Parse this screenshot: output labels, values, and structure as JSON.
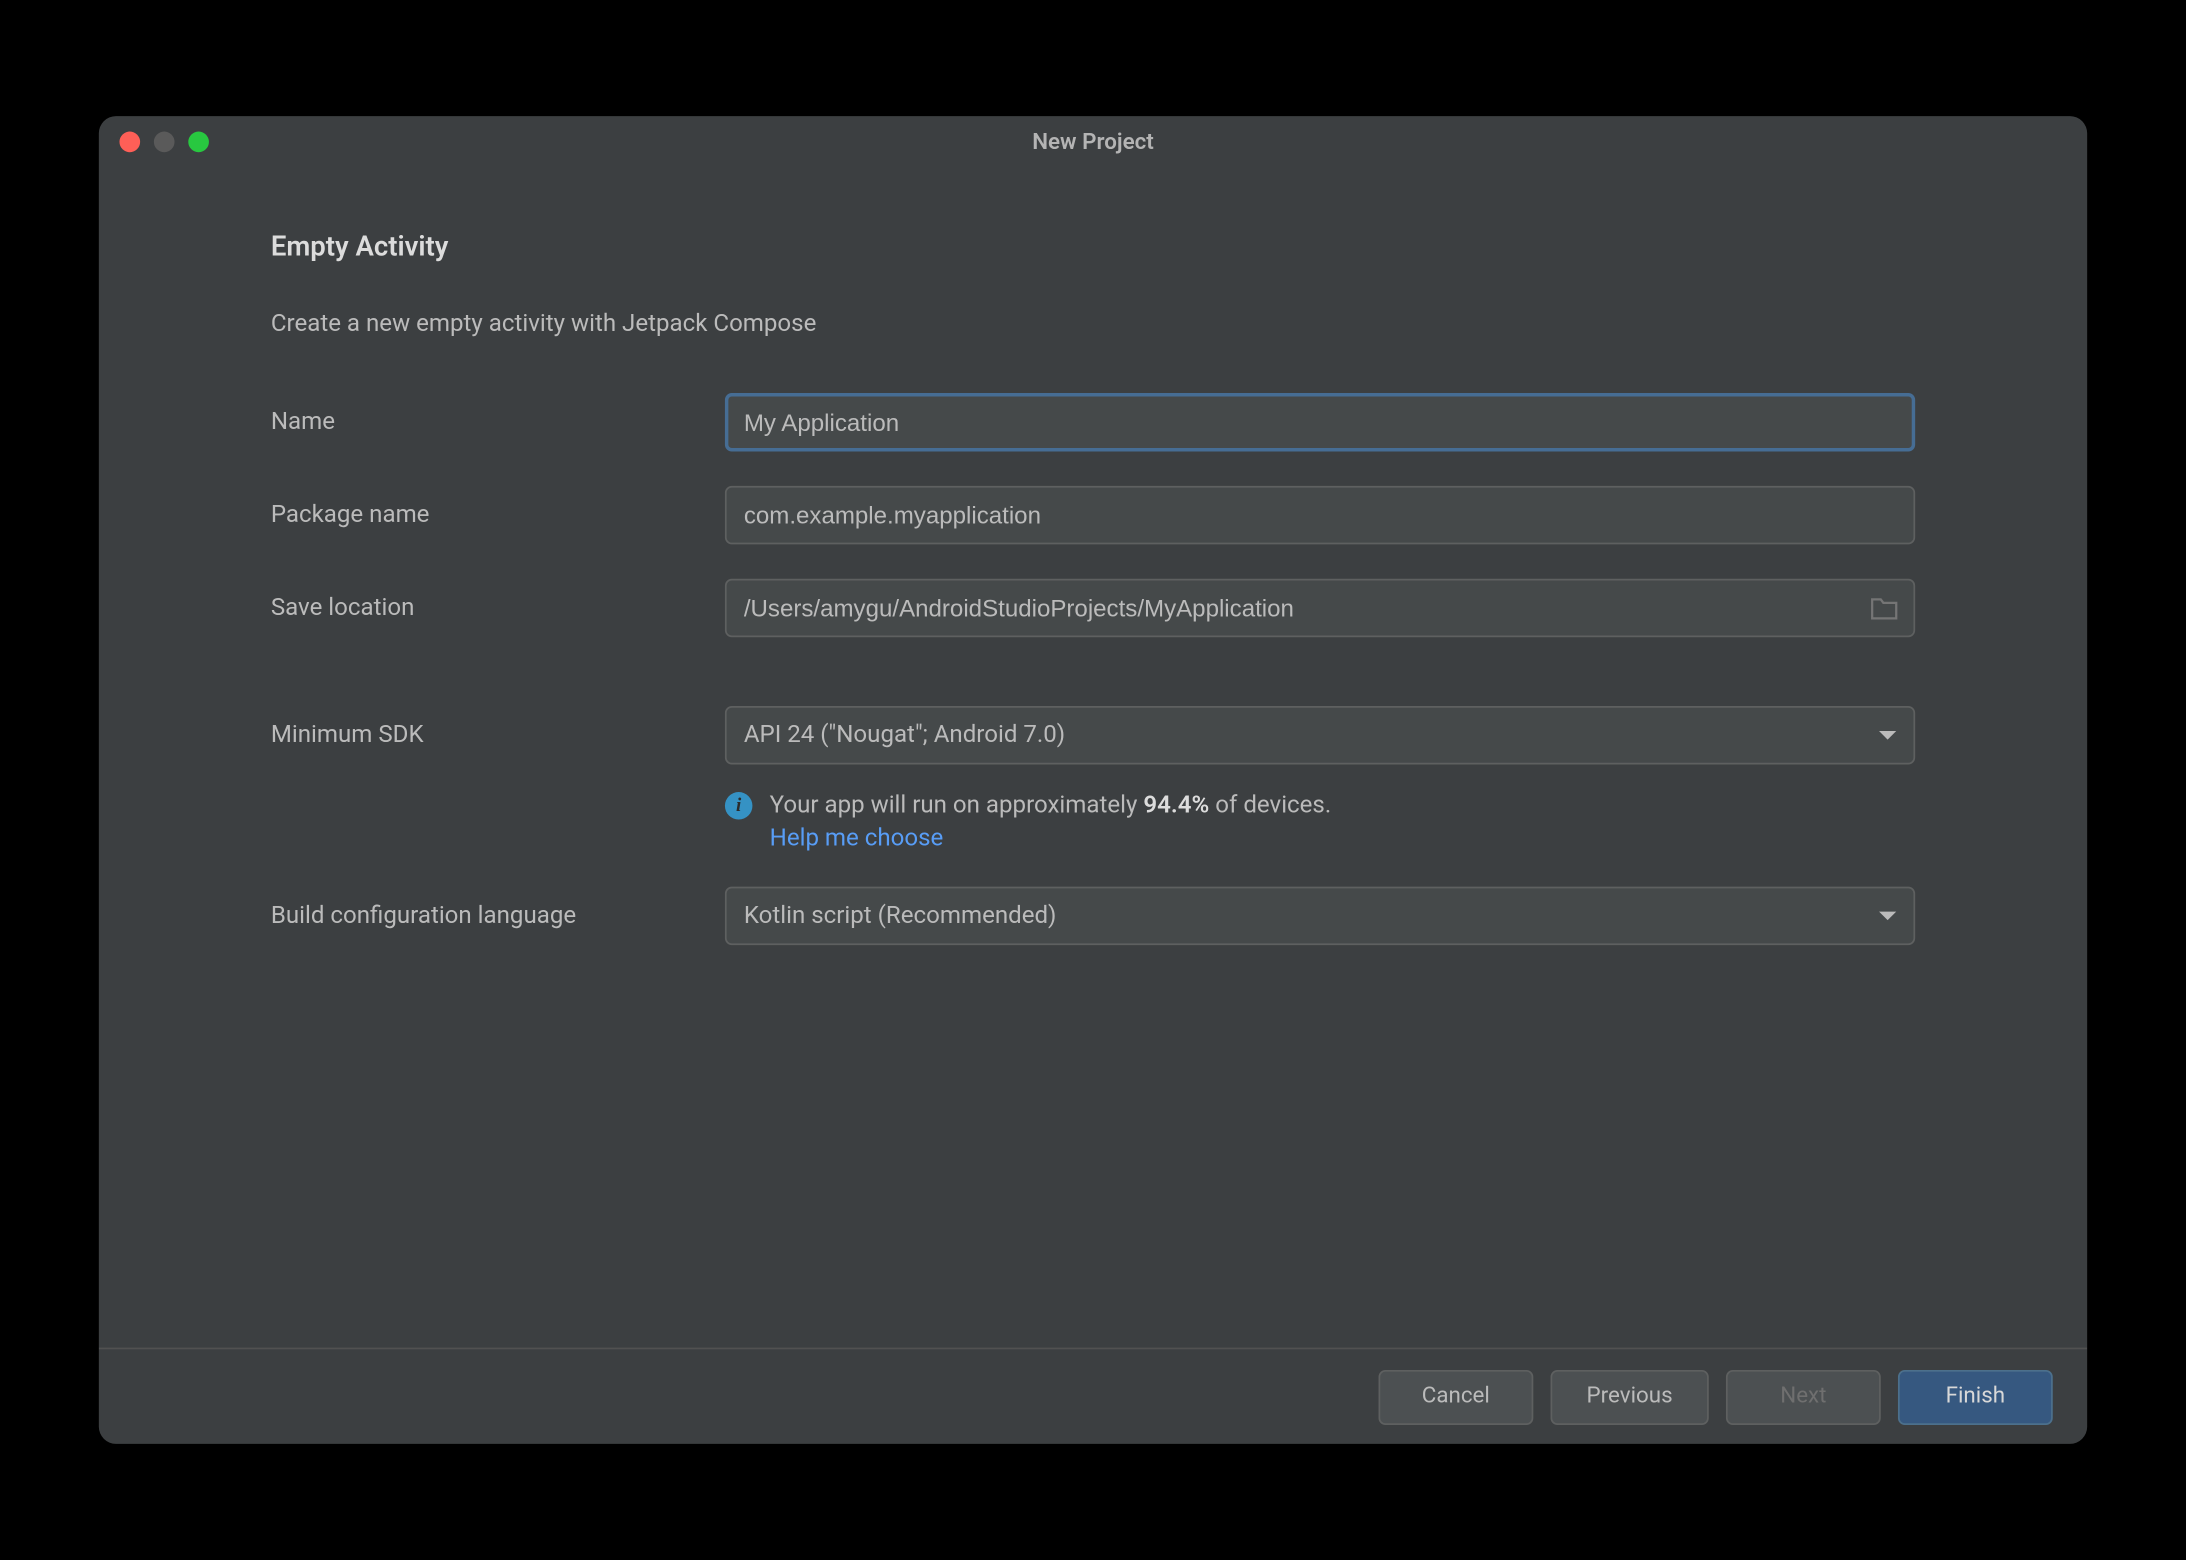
{
  "window": {
    "title": "New Project"
  },
  "section": {
    "title": "Empty Activity",
    "description": "Create a new empty activity with Jetpack Compose"
  },
  "form": {
    "name_label": "Name",
    "name_value": "My Application",
    "package_label": "Package name",
    "package_value": "com.example.myapplication",
    "location_label": "Save location",
    "location_value": "/Users/amygu/AndroidStudioProjects/MyApplication",
    "sdk_label": "Minimum SDK",
    "sdk_value": "API 24 (\"Nougat\"; Android 7.0)",
    "build_lang_label": "Build configuration language",
    "build_lang_value": "Kotlin script (Recommended)"
  },
  "info": {
    "text_prefix": "Your app will run on approximately ",
    "percent": "94.4%",
    "text_suffix": " of devices.",
    "help_link": "Help me choose"
  },
  "buttons": {
    "cancel": "Cancel",
    "previous": "Previous",
    "next": "Next",
    "finish": "Finish"
  }
}
